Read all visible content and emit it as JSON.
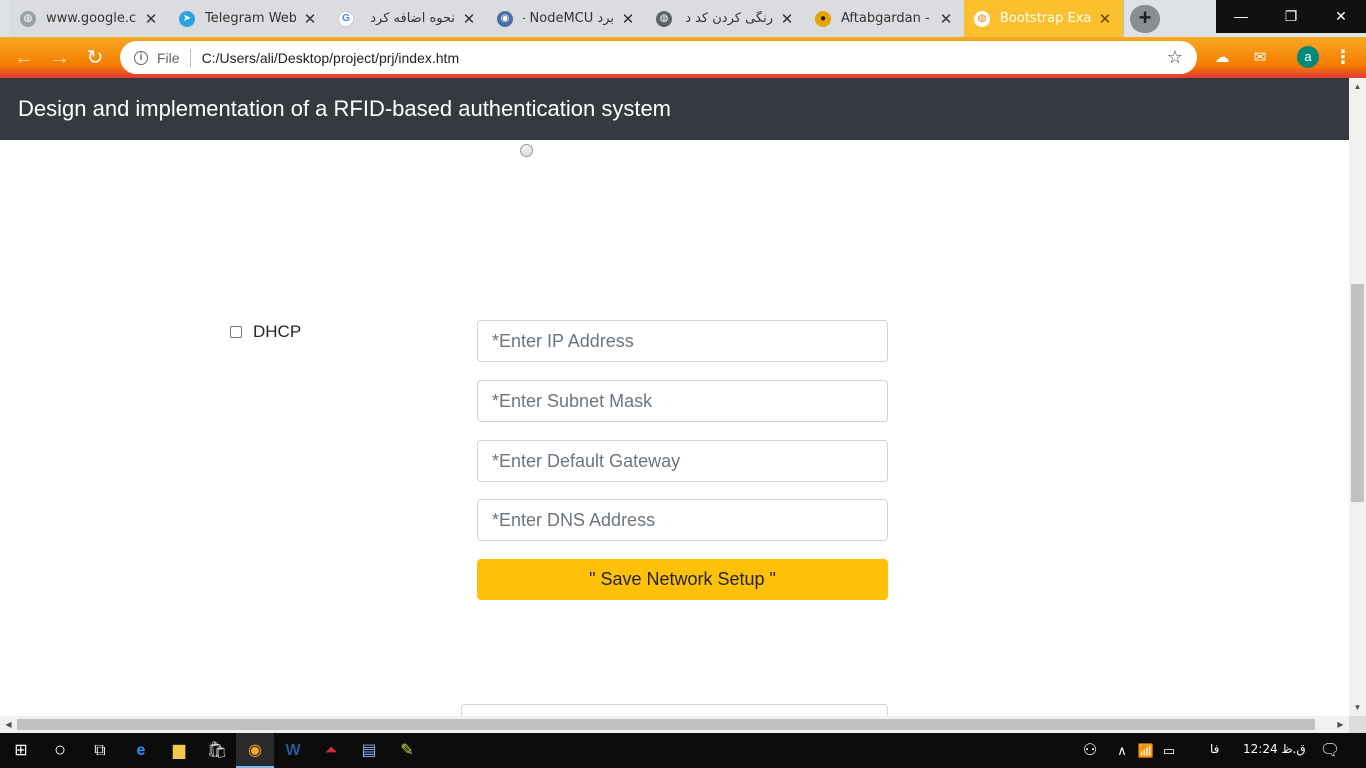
{
  "browser": {
    "tabs": [
      {
        "title": "www.google.co",
        "favicon": "globe-icon",
        "active": false,
        "rtl": false
      },
      {
        "title": "Telegram Web",
        "favicon": "telegram-icon",
        "active": false,
        "rtl": false
      },
      {
        "title": "نحوه اضافه کرد",
        "favicon": "google-icon",
        "active": false,
        "rtl": true
      },
      {
        "title": "برد NodeMCU -",
        "favicon": "nodemcu-icon",
        "active": false,
        "rtl": true
      },
      {
        "title": "رنگی کردن کد د",
        "favicon": "globe-icon",
        "active": false,
        "rtl": true
      },
      {
        "title": "Aftabgardan -",
        "favicon": "aftabgardan-icon",
        "active": false,
        "rtl": false
      },
      {
        "title": "Bootstrap Exan",
        "favicon": "globe-icon",
        "active": true,
        "rtl": false
      }
    ],
    "close_glyph": "✕",
    "new_tab_glyph": "+",
    "window_controls": {
      "minimize": "—",
      "restore": "❐",
      "close": "✕"
    },
    "omnibox": {
      "scheme_label": "File",
      "url": "C:/Users/ali/Desktop/project/prj/index.htm",
      "info_glyph": "i"
    },
    "profile_initial": "a",
    "accent_color": "#fbc02d"
  },
  "page": {
    "title": "Design and implementation of a RFID-based authentication system",
    "dhcp_label": "DHCP",
    "dhcp_checked": false,
    "fields": {
      "ip_placeholder": "*Enter IP Address",
      "subnet_placeholder": "*Enter Subnet Mask",
      "gateway_placeholder": "*Enter Default Gateway",
      "dns_placeholder": "*Enter DNS Address"
    },
    "save_button_label": "\" Save Network Setup \"",
    "button_color": "#ffc107",
    "header_color": "#343a40"
  },
  "taskbar": {
    "language": "فا",
    "clock": "12:24 ق.ظ"
  }
}
